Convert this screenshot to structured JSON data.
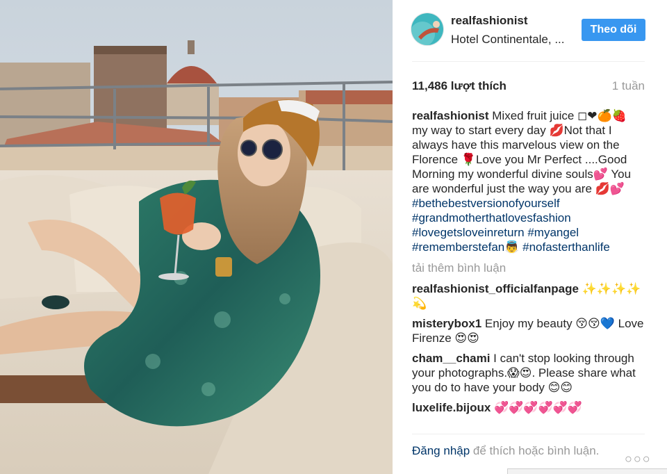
{
  "post": {
    "username": "realfashionist",
    "location": "Hotel Continentale, ...",
    "follow_label": "Theo dõi",
    "likes": "11,486 lượt thích",
    "time_ago": "1 tuần",
    "caption_user": "realfashionist",
    "caption_text_1": " Mixed fruit juice ◻❤🍊🍓 my way to start every day 💋Not that I always have this marvelous view on the Florence 🌹Love you Mr Perfect ....Good Morning my wonderful divine souls💕 You are wonderful just the way you are 💋💕 ",
    "hashtags": [
      "#bethebestversionofyourself",
      "#grandmotherthatlovesfashion",
      "#lovegetsloveinreturn",
      "#myangel",
      "#rememberstefan",
      "#nofasterthanlife"
    ],
    "hashtag_suffix_4": "👼 ",
    "load_more": "tải thêm bình luận",
    "comments": [
      {
        "user": "realfashionist_officialfanpage",
        "text": " ✨✨✨✨💫"
      },
      {
        "user": "misterybox1",
        "text": " Enjoy my beauty 😚😚💙 Love Firenze 😍😍"
      },
      {
        "user": "cham__chami",
        "text": " I can't stop looking through your photographs.😱😍. Please share what you do to have your body 😊😊"
      },
      {
        "user": "luxelife.bijoux",
        "text": " 💞💞💞💞💞💞"
      }
    ],
    "login_link": "Đăng nhập",
    "login_text": " để thích hoặc bình luận.",
    "more_label": "○○○"
  },
  "icons": {
    "avatar": "profile-avatar",
    "more": "more-options-icon"
  },
  "colors": {
    "follow_button": "#3897f0",
    "link": "#003569",
    "muted": "#999999"
  }
}
